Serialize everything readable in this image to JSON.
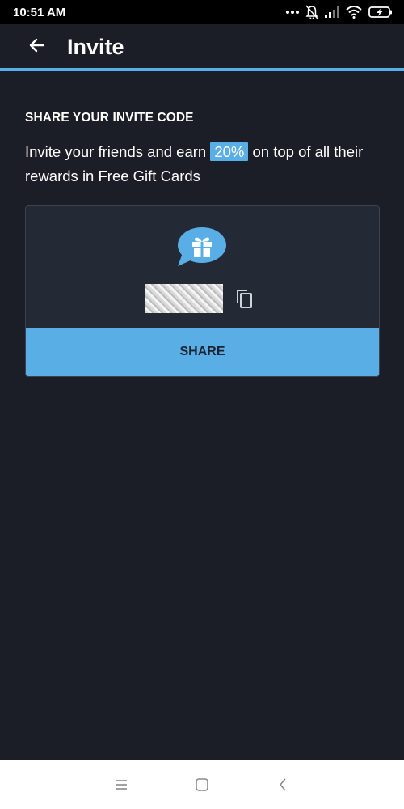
{
  "status_bar": {
    "time": "10:51 AM",
    "icons": [
      "more-dots-icon",
      "muted-bell-icon",
      "signal-icon",
      "wifi-icon",
      "battery-charging-icon"
    ]
  },
  "app_bar": {
    "back_icon": "arrow-back-icon",
    "title": "Invite"
  },
  "invite": {
    "section_title": "SHARE YOUR INVITE CODE",
    "desc_before": "Invite your friends and earn ",
    "desc_highlight": "20%",
    "desc_after": " on top of all their rewards in Free Gift Cards",
    "code_value": "",
    "gift_icon": "gift-chat-bubble-icon",
    "copy_icon": "copy-icon",
    "share_label": "SHARE"
  },
  "nav_bar": {
    "icons": [
      "menu-icon",
      "home-square-icon",
      "back-chevron-icon"
    ]
  },
  "colors": {
    "background": "#1b1e26",
    "accent": "#5aaee6",
    "card": "#242a35"
  }
}
